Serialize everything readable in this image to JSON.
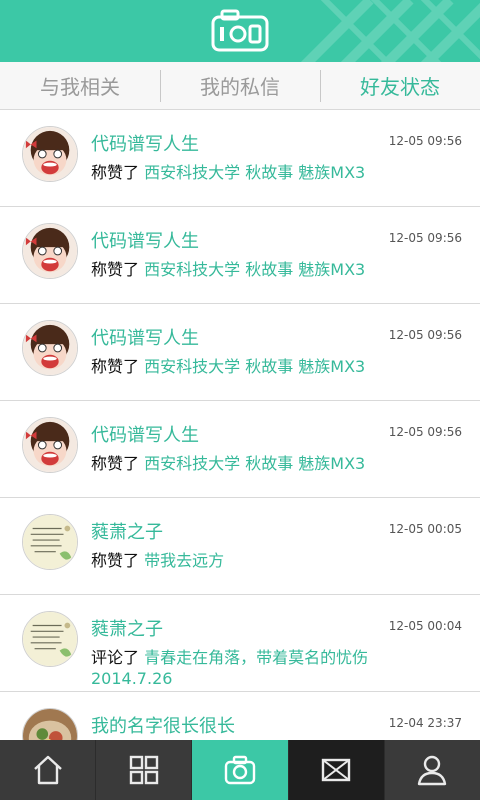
{
  "header": {
    "logo_icon": "camera-logo-icon",
    "accent_color": "#3cc8a6"
  },
  "tabs": [
    {
      "label": "与我相关",
      "active": false
    },
    {
      "label": "我的私信",
      "active": false
    },
    {
      "label": "好友状态",
      "active": true
    }
  ],
  "feed": [
    {
      "name": "代码谱写人生",
      "time": "12-05 09:56",
      "verb": "称赞了",
      "target": "西安科技大学 秋故事 魅族MX3",
      "avatar": "cartoon-girl-avatar"
    },
    {
      "name": "代码谱写人生",
      "time": "12-05 09:56",
      "verb": "称赞了",
      "target": "西安科技大学 秋故事 魅族MX3",
      "avatar": "cartoon-girl-avatar"
    },
    {
      "name": "代码谱写人生",
      "time": "12-05 09:56",
      "verb": "称赞了",
      "target": "西安科技大学 秋故事 魅族MX3",
      "avatar": "cartoon-girl-avatar"
    },
    {
      "name": "代码谱写人生",
      "time": "12-05 09:56",
      "verb": "称赞了",
      "target": "西安科技大学 秋故事 魅族MX3",
      "avatar": "cartoon-girl-avatar"
    },
    {
      "name": "蕤萧之子",
      "time": "12-05 00:05",
      "verb": "称赞了",
      "target": "带我去远方",
      "avatar": "handwriting-avatar"
    },
    {
      "name": "蕤萧之子",
      "time": "12-05 00:04",
      "verb": "评论了",
      "target": "青春走在角落，带着莫名的忧伤2014.7.26",
      "avatar": "handwriting-avatar"
    },
    {
      "name": "我的名字很长很长",
      "time": "12-04 23:37",
      "verb": "",
      "target": "",
      "avatar": "food-photo-avatar"
    }
  ],
  "bottom_nav": [
    {
      "icon": "home-icon"
    },
    {
      "icon": "grid-icon"
    },
    {
      "icon": "camera-icon"
    },
    {
      "icon": "mail-icon"
    },
    {
      "icon": "user-icon"
    }
  ]
}
